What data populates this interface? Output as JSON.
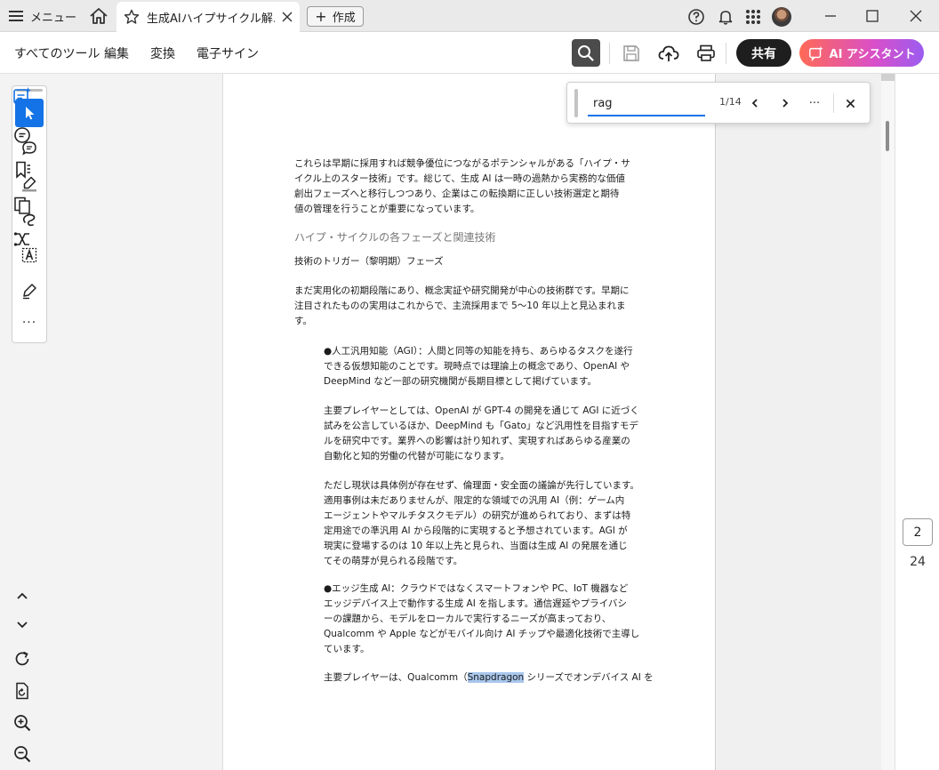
{
  "titlebar": {
    "menu_label": "メニュー",
    "tab_title": "生成AIハイプサイクル解...",
    "create_label": "作成"
  },
  "toolbar": {
    "menus": [
      "すべてのツール",
      "編集",
      "変換",
      "電子サイン"
    ],
    "share_label": "共有",
    "ai_label": "AI アシスタント"
  },
  "find": {
    "query": "rag",
    "count": "1/14",
    "more": "···"
  },
  "tool_rail": {
    "more": "···"
  },
  "document": {
    "para1": [
      "これらは早期に採用すれば競争優位につながるポテンシャルがある「ハイプ・サ",
      "イクル上のスター技術」です。総じて、生成 AI は一時の過熱から実務的な価値",
      "創出フェーズへと移行しつつあり、企業はこの転換期に正しい技術選定と期待",
      "値の管理を行うことが重要になっています。"
    ],
    "heading": "ハイプ・サイクルの各フェーズと関連技術",
    "subheading": "技術のトリガー（黎明期）フェーズ",
    "para2": [
      "まだ実用化の初期段階にあり、概念実証や研究開発が中心の技術群です。早期に",
      "注目されたものの実用はこれからで、主流採用まで 5～10 年以上と見込まれま",
      "す。"
    ],
    "para3": [
      "●人工汎用知能（AGI）：人間と同等の知能を持ち、あらゆるタスクを遂行",
      "できる仮想知能のことです。現時点では理論上の概念であり、OpenAI や",
      "DeepMind など一部の研究機関が長期目標として掲げています。"
    ],
    "para4": [
      "主要プレイヤーとしては、OpenAI が GPT-4 の開発を通じて AGI に近づく",
      "試みを公言しているほか、DeepMind も「Gato」など汎用性を目指すモデ",
      "ルを研究中です。業界への影響は計り知れず、実現すればあらゆる産業の",
      "自動化と知的労働の代替が可能になります。"
    ],
    "para5": [
      "ただし現状は具体例が存在せず、倫理面・安全面の議論が先行しています。",
      "適用事例は未だありませんが、限定的な領域での汎用 AI（例：ゲーム内",
      "エージェントやマルチタスクモデル）の研究が進められており、まずは特",
      "定用途での準汎用 AI から段階的に実現すると予想されています。AGI が",
      "現実に登場するのは 10 年以上先と見られ、当面は生成 AI の発展を通じ",
      "てその萌芽が見られる段階です。"
    ],
    "para6": [
      "●エッジ生成 AI：クラウドではなくスマートフォンや PC、IoT 機器など",
      "エッジデバイス上で動作する生成 AI を指します。通信遅延やプライバシ",
      "ーの課題から、モデルをローカルで実行するニーズが高まっており、",
      "Qualcomm や Apple などがモバイル向け AI チップや最適化技術で主導し",
      "ています。"
    ],
    "para7_before": "主要プレイヤーは、Qualcomm（",
    "para7_highlight": "Snapdragon",
    "para7_after": " シリーズでオンデバイス AI を"
  },
  "pager": {
    "current": "2",
    "total": "24"
  },
  "colors": {
    "accent": "#1473e6",
    "share_bg": "#1e1e1e",
    "search_highlight": "#a9c7ec"
  }
}
